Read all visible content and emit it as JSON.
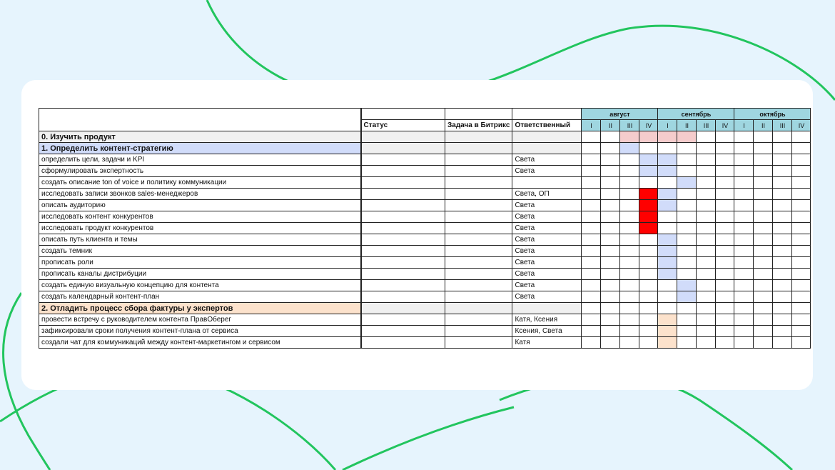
{
  "colors": {
    "background": "#e6f4fd",
    "curve": "#22c55e",
    "card": "#ffffff",
    "header_fill": "#9fd6e0",
    "section_blue": "#d1dcfa",
    "section_orange": "#fce2cc",
    "pink": "#f5cccc",
    "red": "#ff0000",
    "grey": "#f0f0f0"
  },
  "table": {
    "headers": {
      "status": "Статус",
      "bitrix_task": "Задача в Битрикс",
      "responsible": "Ответственный"
    },
    "months": [
      "август",
      "сентябрь",
      "октябрь"
    ],
    "weeks": [
      "I",
      "II",
      "III",
      "IV"
    ],
    "rows": [
      {
        "task": "0. Изучить продукт",
        "responsible": "",
        "kind": "section-grey",
        "cells": [
          "",
          "",
          "pk",
          "pk",
          "pk",
          "pk",
          "",
          "",
          "",
          "",
          "",
          ""
        ]
      },
      {
        "task": "1. Определить контент-стратегию",
        "responsible": "",
        "kind": "section-blue",
        "cells": [
          "",
          "",
          "bl",
          "",
          "",
          "",
          "",
          "",
          "",
          "",
          "",
          ""
        ]
      },
      {
        "task": "определить цели, задачи и KPI",
        "responsible": "Света",
        "kind": "task",
        "cells": [
          "",
          "",
          "",
          "bl",
          "bl",
          "",
          "",
          "",
          "",
          "",
          "",
          ""
        ]
      },
      {
        "task": "сформулировать экспертность",
        "responsible": "Света",
        "kind": "task",
        "cells": [
          "",
          "",
          "",
          "bl",
          "bl",
          "",
          "",
          "",
          "",
          "",
          "",
          ""
        ]
      },
      {
        "task": "создать описание ton of voice и политику коммуникации",
        "responsible": "",
        "kind": "task",
        "cells": [
          "",
          "",
          "",
          "",
          "",
          "bl",
          "",
          "",
          "",
          "",
          "",
          ""
        ]
      },
      {
        "task": "исследовать записи звонков sales-менеджеров",
        "responsible": "Света, ОП",
        "kind": "task",
        "cells": [
          "",
          "",
          "",
          "red",
          "bl",
          "",
          "",
          "",
          "",
          "",
          "",
          ""
        ]
      },
      {
        "task": "описать аудиторию",
        "responsible": "Света",
        "kind": "task",
        "cells": [
          "",
          "",
          "",
          "red",
          "bl",
          "",
          "",
          "",
          "",
          "",
          "",
          ""
        ]
      },
      {
        "task": "исследовать контент конкурентов",
        "responsible": "Света",
        "kind": "task",
        "cells": [
          "",
          "",
          "",
          "red",
          "",
          "",
          "",
          "",
          "",
          "",
          "",
          ""
        ]
      },
      {
        "task": "исследовать продукт конкурентов",
        "responsible": "Света",
        "kind": "task",
        "cells": [
          "",
          "",
          "",
          "red",
          "",
          "",
          "",
          "",
          "",
          "",
          "",
          ""
        ]
      },
      {
        "task": "описать путь клиента и темы",
        "responsible": "Света",
        "kind": "task",
        "cells": [
          "",
          "",
          "",
          "",
          "bl",
          "",
          "",
          "",
          "",
          "",
          "",
          ""
        ]
      },
      {
        "task": "создать темник",
        "responsible": "Света",
        "kind": "task",
        "cells": [
          "",
          "",
          "",
          "",
          "bl",
          "",
          "",
          "",
          "",
          "",
          "",
          ""
        ]
      },
      {
        "task": "прописать роли",
        "responsible": "Света",
        "kind": "task",
        "cells": [
          "",
          "",
          "",
          "",
          "bl",
          "",
          "",
          "",
          "",
          "",
          "",
          ""
        ]
      },
      {
        "task": "прописать каналы дистрибуции",
        "responsible": "Света",
        "kind": "task",
        "cells": [
          "",
          "",
          "",
          "",
          "bl",
          "",
          "",
          "",
          "",
          "",
          "",
          ""
        ]
      },
      {
        "task": "создать единую визуальную концепцию для контента",
        "responsible": "Света",
        "kind": "task",
        "cells": [
          "",
          "",
          "",
          "",
          "",
          "bl",
          "",
          "",
          "",
          "",
          "",
          ""
        ]
      },
      {
        "task": "создать календарный контент-план",
        "responsible": "Света",
        "kind": "task",
        "cells": [
          "",
          "",
          "",
          "",
          "",
          "bl",
          "",
          "",
          "",
          "",
          "",
          ""
        ]
      },
      {
        "task": "2. Отладить процесс сбора фактуры у экспертов",
        "responsible": "",
        "kind": "section-orange",
        "cells": [
          "",
          "",
          "",
          "",
          "",
          "",
          "",
          "",
          "",
          "",
          "",
          ""
        ]
      },
      {
        "task": "провести встречу с руководителем контента ПравОберег",
        "responsible": "Катя, Ксения",
        "kind": "task",
        "cells": [
          "",
          "",
          "",
          "",
          "or",
          "",
          "",
          "",
          "",
          "",
          "",
          ""
        ]
      },
      {
        "task": "зафиксировали сроки получения контент-плана от сервиса",
        "responsible": "Ксения, Света",
        "kind": "task",
        "cells": [
          "",
          "",
          "",
          "",
          "or",
          "",
          "",
          "",
          "",
          "",
          "",
          ""
        ]
      },
      {
        "task": "создали чат для коммуникаций между контент-маркетингом и сервисом",
        "responsible": "Катя",
        "kind": "task",
        "cells": [
          "",
          "",
          "",
          "",
          "or",
          "",
          "",
          "",
          "",
          "",
          "",
          ""
        ]
      }
    ]
  }
}
